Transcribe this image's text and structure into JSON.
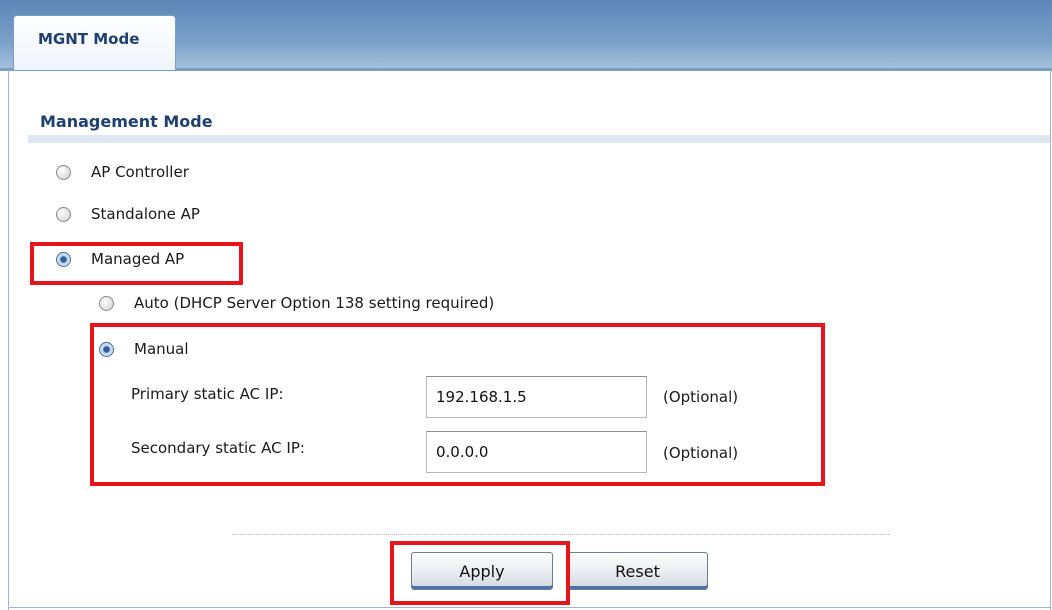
{
  "tab": {
    "label": "MGNT Mode"
  },
  "section": {
    "title": "Management Mode"
  },
  "mode_options": [
    {
      "label": "AP Controller",
      "selected": false
    },
    {
      "label": "Standalone AP",
      "selected": false
    },
    {
      "label": "Managed AP",
      "selected": true
    }
  ],
  "managed_options": [
    {
      "label": "Auto (DHCP Server Option 138 setting required)",
      "selected": false
    },
    {
      "label": "Manual",
      "selected": true
    }
  ],
  "fields": {
    "primary": {
      "label": "Primary static AC IP:",
      "value": "192.168.1.5",
      "note": "(Optional)"
    },
    "secondary": {
      "label": "Secondary static AC IP:",
      "value": "0.0.0.0",
      "note": "(Optional)"
    }
  },
  "buttons": {
    "apply": "Apply",
    "reset": "Reset"
  },
  "colors": {
    "highlight": "#e8141c",
    "accent": "#1f3f6f",
    "header": "#7aa0c9"
  }
}
